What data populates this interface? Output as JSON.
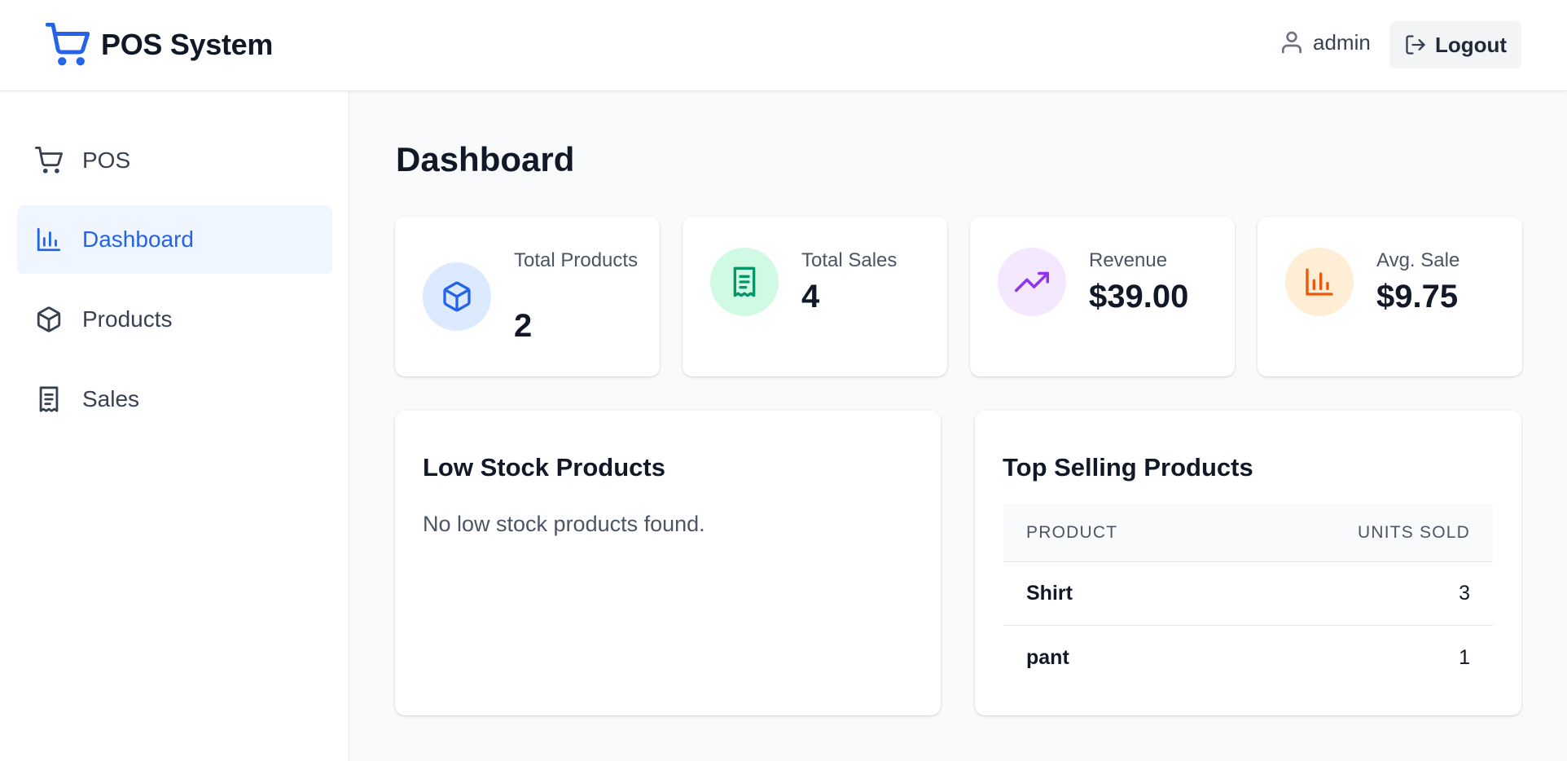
{
  "app": {
    "title": "POS System"
  },
  "header": {
    "username": "admin",
    "logout_label": "Logout"
  },
  "sidebar": {
    "items": [
      {
        "label": "POS",
        "icon": "cart-icon",
        "active": false
      },
      {
        "label": "Dashboard",
        "icon": "bar-chart-icon",
        "active": true
      },
      {
        "label": "Products",
        "icon": "box-icon",
        "active": false
      },
      {
        "label": "Sales",
        "icon": "receipt-icon",
        "active": false
      }
    ]
  },
  "main": {
    "title": "Dashboard",
    "stats": [
      {
        "label": "Total Products",
        "value": "2",
        "icon": "box-icon",
        "color": "#2563eb",
        "bg": "#dbeafe"
      },
      {
        "label": "Total Sales",
        "value": "4",
        "icon": "receipt-icon",
        "color": "#059669",
        "bg": "#d1fae5"
      },
      {
        "label": "Revenue",
        "value": "$39.00",
        "icon": "trending-up-icon",
        "color": "#9333ea",
        "bg": "#f3e8ff"
      },
      {
        "label": "Avg. Sale",
        "value": "$9.75",
        "icon": "bar-chart-icon",
        "color": "#ea580c",
        "bg": "#ffedd5"
      }
    ],
    "low_stock": {
      "title": "Low Stock Products",
      "empty_message": "No low stock products found."
    },
    "top_selling": {
      "title": "Top Selling Products",
      "columns": [
        "PRODUCT",
        "UNITS SOLD"
      ],
      "rows": [
        {
          "product": "Shirt",
          "units": "3"
        },
        {
          "product": "pant",
          "units": "1"
        }
      ]
    }
  },
  "colors": {
    "accent": "#2563eb",
    "active_bg": "#eff6ff",
    "main_bg": "#f9fafb"
  }
}
